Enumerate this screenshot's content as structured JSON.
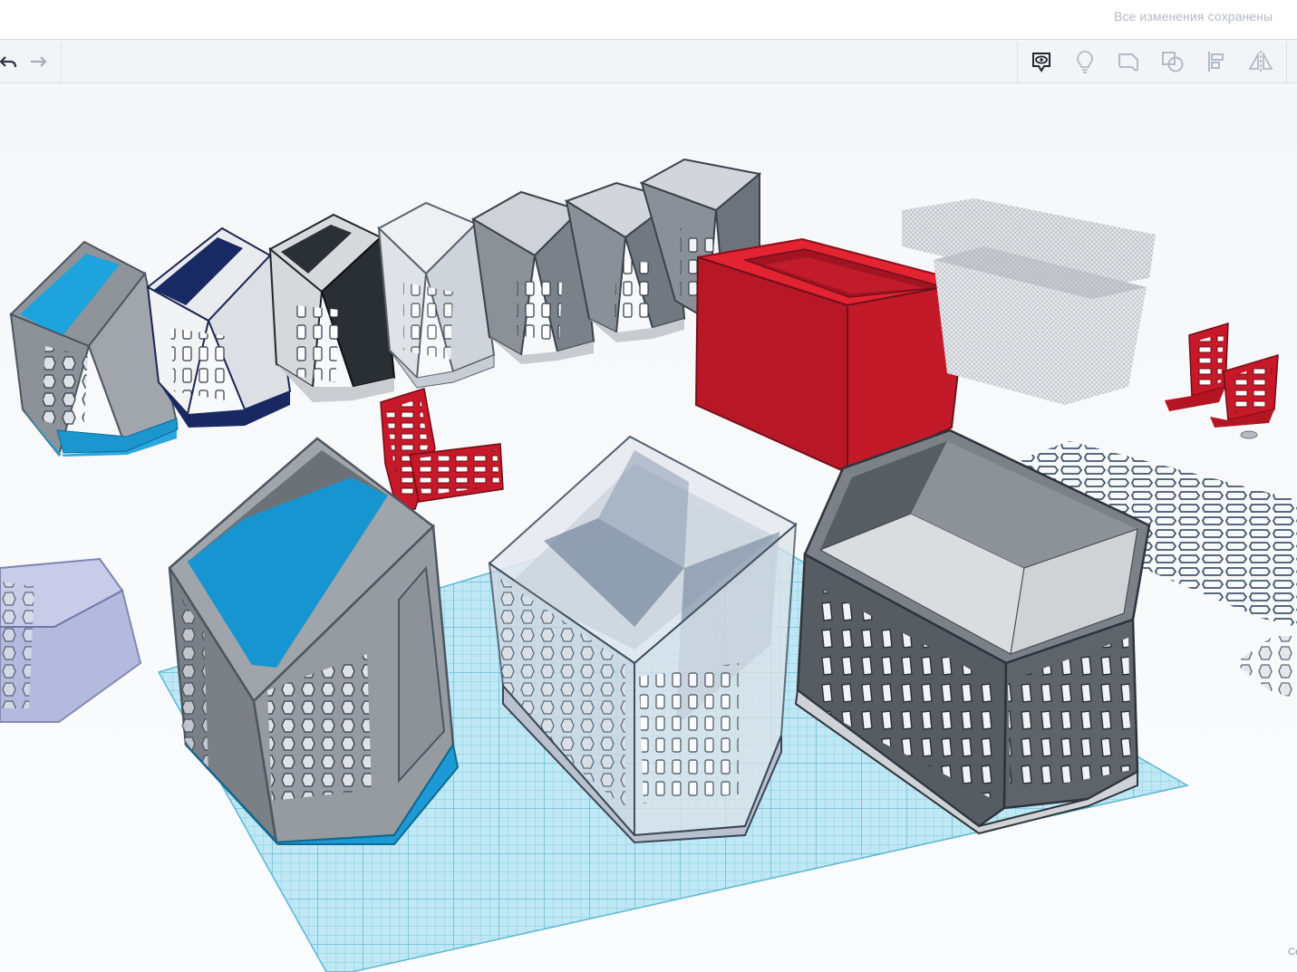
{
  "header": {
    "save_status": "Все изменения сохранены"
  },
  "toolbar": {
    "undo_icon": "undo-arrow-icon",
    "redo_icon": "redo-arrow-icon",
    "right_tools": [
      {
        "name": "show-all-icon"
      },
      {
        "name": "light-bulb-icon"
      },
      {
        "name": "group-icon"
      },
      {
        "name": "ungroup-icon"
      },
      {
        "name": "align-icon"
      },
      {
        "name": "mirror-icon"
      }
    ]
  },
  "viewport": {
    "corner_text": "Се",
    "workplane_color": "#7fd0e8",
    "colors": {
      "blue": "#1e9ad6",
      "navy": "#1b2b63",
      "black": "#2b2f36",
      "gray": "#8d9298",
      "dark_gray": "#51575e",
      "red": "#c71a2a",
      "translucent": "#b9c3d3"
    }
  }
}
